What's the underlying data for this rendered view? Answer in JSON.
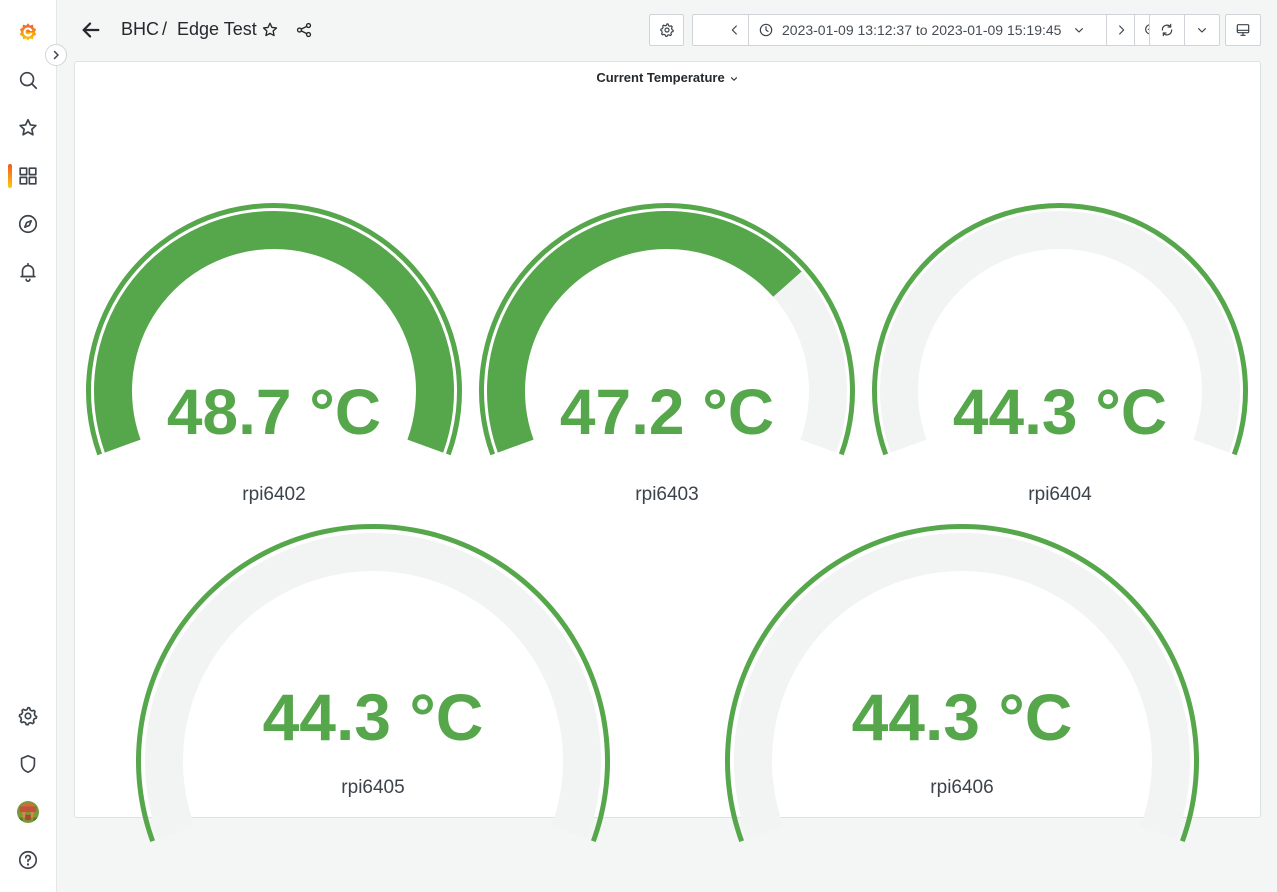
{
  "breadcrumb": {
    "folder": "BHC",
    "separator": " / ",
    "dashboard": "Edge Test"
  },
  "time_range": {
    "text": "2023-01-09 13:12:37 to 2023-01-09 15:19:45"
  },
  "panel": {
    "title": "Current Temperature"
  },
  "gauges": [
    {
      "name": "rpi6402",
      "display": "48.7 °C",
      "value": 48.7,
      "fill_fraction": 1.0
    },
    {
      "name": "rpi6403",
      "display": "47.2 °C",
      "value": 47.2,
      "fill_fraction": 0.72
    },
    {
      "name": "rpi6404",
      "display": "44.3 °C",
      "value": 44.3,
      "fill_fraction": 0.0
    },
    {
      "name": "rpi6405",
      "display": "44.3 °C",
      "value": 44.3,
      "fill_fraction": 0.0
    },
    {
      "name": "rpi6406",
      "display": "44.3 °C",
      "value": 44.3,
      "fill_fraction": 0.0
    }
  ],
  "colors": {
    "gauge_green": "#56a64b",
    "gauge_track": "#f2f3f3",
    "sidebar_active": "#f05a28"
  },
  "icons": {
    "sidebar": [
      "grafana-logo-icon",
      "search-icon",
      "star-icon",
      "dashboards-icon",
      "explore-icon",
      "alerting-icon",
      "gear-icon",
      "shield-icon",
      "avatar",
      "help-icon"
    ],
    "toolbar": [
      "back-arrow-icon",
      "star-icon",
      "share-icon",
      "gear-icon",
      "chevron-left-icon",
      "clock-icon",
      "chevron-down-icon",
      "chevron-right-icon",
      "zoom-out-icon",
      "refresh-icon",
      "chevron-down-icon",
      "tv-mode-icon"
    ]
  }
}
